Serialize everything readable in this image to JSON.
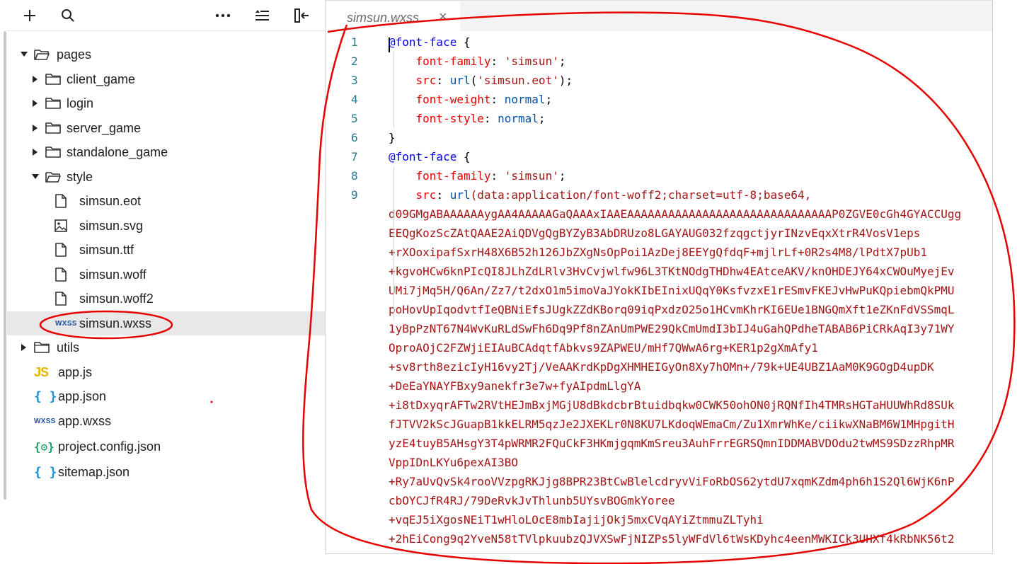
{
  "explorer": {
    "toolbar": [
      {
        "name": "add-icon",
        "glyph": "plus"
      },
      {
        "name": "search-icon",
        "glyph": "magnifier"
      },
      {
        "name": "more-icon",
        "glyph": "ellipsis"
      },
      {
        "name": "collapse-icon",
        "glyph": "list-sort"
      },
      {
        "name": "split-icon",
        "glyph": "split-left"
      }
    ],
    "tree": [
      {
        "label": "pages",
        "depth": 0,
        "kind": "folder-open",
        "expanded": true
      },
      {
        "label": "client_game",
        "depth": 1,
        "kind": "folder",
        "expanded": false
      },
      {
        "label": "login",
        "depth": 1,
        "kind": "folder",
        "expanded": false
      },
      {
        "label": "server_game",
        "depth": 1,
        "kind": "folder",
        "expanded": false
      },
      {
        "label": "standalone_game",
        "depth": 1,
        "kind": "folder",
        "expanded": false
      },
      {
        "label": "style",
        "depth": 1,
        "kind": "folder-open",
        "expanded": true
      },
      {
        "label": "simsun.eot",
        "depth": 2,
        "kind": "file"
      },
      {
        "label": "simsun.svg",
        "depth": 2,
        "kind": "image"
      },
      {
        "label": "simsun.ttf",
        "depth": 2,
        "kind": "file"
      },
      {
        "label": "simsun.woff",
        "depth": 2,
        "kind": "file"
      },
      {
        "label": "simsun.woff2",
        "depth": 2,
        "kind": "file"
      },
      {
        "label": "simsun.wxss",
        "depth": 2,
        "kind": "wxss",
        "selected": true
      },
      {
        "label": "utils",
        "depth": 0,
        "kind": "folder",
        "expanded": false
      },
      {
        "label": "app.js",
        "depth": 0,
        "kind": "js"
      },
      {
        "label": "app.json",
        "depth": 0,
        "kind": "json"
      },
      {
        "label": "app.wxss",
        "depth": 0,
        "kind": "wxss"
      },
      {
        "label": "project.config.json",
        "depth": 0,
        "kind": "config"
      },
      {
        "label": "sitemap.json",
        "depth": 0,
        "kind": "json"
      }
    ],
    "icon_text": {
      "js": "JS",
      "json": "{ }",
      "wxss": "WXSS",
      "config": "{⚙}"
    }
  },
  "editor": {
    "tab": {
      "title": "simsun.wxss",
      "close": "×"
    },
    "lines": [
      {
        "num": "1",
        "tokens": [
          {
            "t": "@font-face",
            "c": "kw"
          },
          {
            "t": " {",
            "c": ""
          }
        ]
      },
      {
        "num": "2",
        "tokens": [
          {
            "t": "    ",
            "c": ""
          },
          {
            "t": "font-family",
            "c": "prop"
          },
          {
            "t": ": ",
            "c": ""
          },
          {
            "t": "'simsun'",
            "c": "str"
          },
          {
            "t": ";",
            "c": ""
          }
        ]
      },
      {
        "num": "3",
        "tokens": [
          {
            "t": "    ",
            "c": ""
          },
          {
            "t": "src",
            "c": "prop"
          },
          {
            "t": ": ",
            "c": ""
          },
          {
            "t": "url",
            "c": "val"
          },
          {
            "t": "(",
            "c": ""
          },
          {
            "t": "'simsun.eot'",
            "c": "str"
          },
          {
            "t": ");",
            "c": ""
          }
        ]
      },
      {
        "num": "4",
        "tokens": [
          {
            "t": "    ",
            "c": ""
          },
          {
            "t": "font-weight",
            "c": "prop"
          },
          {
            "t": ": ",
            "c": ""
          },
          {
            "t": "normal",
            "c": "val"
          },
          {
            "t": ";",
            "c": ""
          }
        ]
      },
      {
        "num": "5",
        "tokens": [
          {
            "t": "    ",
            "c": ""
          },
          {
            "t": "font-style",
            "c": "prop"
          },
          {
            "t": ": ",
            "c": ""
          },
          {
            "t": "normal",
            "c": "val"
          },
          {
            "t": ";",
            "c": ""
          }
        ]
      },
      {
        "num": "6",
        "tokens": [
          {
            "t": "}",
            "c": ""
          }
        ]
      },
      {
        "num": "7",
        "tokens": [
          {
            "t": "@font-face",
            "c": "kw"
          },
          {
            "t": " {",
            "c": ""
          }
        ]
      },
      {
        "num": "8",
        "tokens": [
          {
            "t": "    ",
            "c": ""
          },
          {
            "t": "font-family",
            "c": "prop"
          },
          {
            "t": ": ",
            "c": ""
          },
          {
            "t": "'simsun'",
            "c": "str"
          },
          {
            "t": ";",
            "c": ""
          }
        ]
      },
      {
        "num": "9",
        "tokens": [
          {
            "t": "    ",
            "c": ""
          },
          {
            "t": "src",
            "c": "prop"
          },
          {
            "t": ": ",
            "c": ""
          },
          {
            "t": "url",
            "c": "val"
          },
          {
            "t": "(data:application/font-woff2;charset=utf-8;base64,",
            "c": "str"
          }
        ]
      }
    ],
    "wrapped": [
      "d09GMgABAAAAAAygAA4AAAAAGaQAAAxIAAEAAAAAAAAAAAAAAAAAAAAAAAAAAAAAAP0ZGVE0cGh4GYACCUgg",
      "EEQgKozScZAtQAAE2AiQDVgQgBYZyB3AbDRUzo8LGAYAUG032fzqgctjyrINzvEqxXtrR4VosV1eps",
      "+rXOoxipafSxrH48X6B52h126JbZXgNsOpPoi1AzDej8EEYgQfdqF+mjlrLf+0R2s4M8/lPdtX7pUb1",
      "+kgvoHCw6knPIcQI8JLhZdLRlv3HvCvjwlfw96L3TKtNOdgTHDhw4EAtceAKV/knOHDEJY64xCWOuMyejEv",
      "UMi7jMq5H/Q6An/Zz7/t2dxO1m5imoVaJYokKIbEInixUQqY0KsfvzxE1rESmvFKEJvHwPuKQpiebmQkPMU",
      "poHovUpIqodvtfIeQBNiEfsJUgkZZdKBorq09iqPxdzO25o1HCvmKhrKI6EUe1BNGQmXft1eZKnFdVSSmqL",
      "1yBpPzNT67N4WvKuRLdSwFh6Dq9Pf8nZAnUmPWE29QkCmUmdI3bIJ4uGahQPdheTABAB6PiCRkAqI3y71WY",
      "OproAOjC2FZWjiEIAuBCAdqtfAbkvs9ZAPWEU/mHf7QWwA6rg+KER1p2gXmAfy1",
      "+sv8rth8ezicIyH16vy2Tj/VeAAKrdKpDgXHMHEIGyOn8Xy7hOMn+/79k+UE4UBZ1AaM0K9GOgD4upDK",
      "+DeEaYNAYFBxy9anekfr3e7w+fyAIpdmLlgYA",
      "+i8tDxyqrAFTw2RVtHEJmBxjMGjU8dBkdcbrBtuidbqkw0CWK50ohON0jRQNfIh4TMRsHGTaHUUWhRd8SUk",
      "fJTVV2kScJGuapB1kkELRM5qzJe2JXEKLr0N8KU7LKdoqWEmaCm/Zu1XmrWhKe/ciikwXNaBM6W1MHpgitH",
      "yzE4tuyB5AHsgY3T4pWRMR2FQuCkF3HKmjgqmKmSreu3AuhFrrEGRSQmnIDDMABVDOdu2twMS9SDzzRhpMR",
      "VppIDnLKYu6pexAI3BO",
      "+Ry7aUvQvSk4rooVVzpgRKJjg8BPR23BtCwBlelcdryvViFoRbOS62ytdU7xqmKZdm4ph6h1S2Ql6WjK6nP",
      "cbOYCJfR4RJ/79DeRvkJvThlunb5UYsvBOGmkYoree",
      "+vqEJ5iXgosNEiT1wHloLOcE8mbIajijOkj5mxCVqAYiZtmmuZLTyhi",
      "+2hEiCong9q2YveN58tTVlpkuubzQJVXSwFjNIZPs5lyWFdVl6tWsKDyhc4eenMWKICk3UHXf4kRbNK56t2"
    ]
  }
}
